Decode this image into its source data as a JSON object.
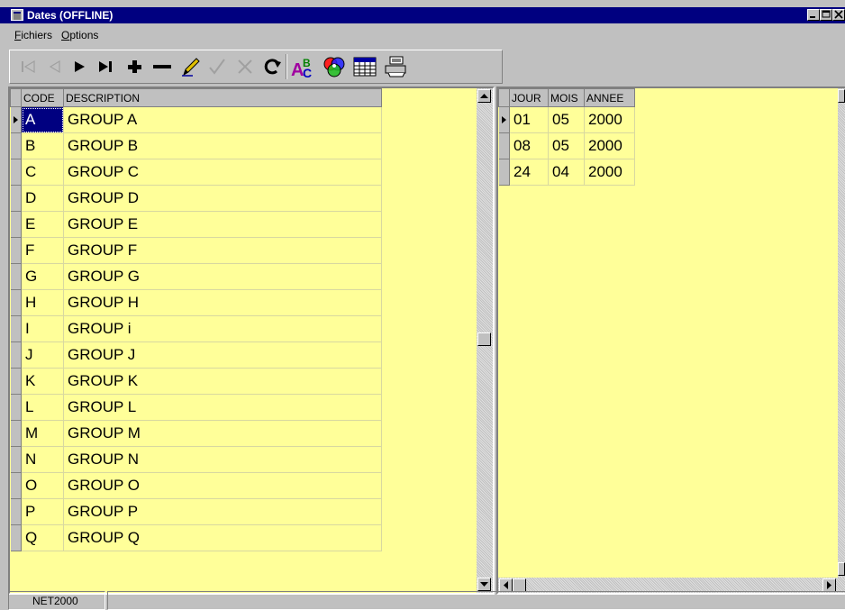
{
  "window": {
    "title": "Dates (OFFLINE)"
  },
  "menu": {
    "items": [
      {
        "label": "Fichiers"
      },
      {
        "label": "Options"
      }
    ]
  },
  "toolbar": {
    "buttons": [
      {
        "icon": "first-record-icon",
        "enabled": false
      },
      {
        "icon": "prior-record-icon",
        "enabled": false
      },
      {
        "icon": "next-record-icon",
        "enabled": true
      },
      {
        "icon": "last-record-icon",
        "enabled": true
      },
      {
        "icon": "insert-record-icon",
        "enabled": true
      },
      {
        "icon": "delete-record-icon",
        "enabled": true
      },
      {
        "icon": "edit-record-icon",
        "enabled": true
      },
      {
        "icon": "post-edit-icon",
        "enabled": false
      },
      {
        "icon": "cancel-edit-icon",
        "enabled": false
      },
      {
        "icon": "refresh-icon",
        "enabled": true
      },
      {
        "icon": "spelling-icon",
        "enabled": true
      },
      {
        "icon": "color-palette-icon",
        "enabled": true
      },
      {
        "icon": "calendar-icon",
        "enabled": true
      },
      {
        "icon": "printer-icon",
        "enabled": true
      }
    ]
  },
  "groups_grid": {
    "columns": [
      "CODE",
      "DESCRIPTION"
    ],
    "rows": [
      [
        "A",
        "GROUP A"
      ],
      [
        "B",
        "GROUP B"
      ],
      [
        "C",
        "GROUP C"
      ],
      [
        "D",
        "GROUP D"
      ],
      [
        "E",
        "GROUP E"
      ],
      [
        "F",
        "GROUP F"
      ],
      [
        "G",
        "GROUP G"
      ],
      [
        "H",
        "GROUP H"
      ],
      [
        "I",
        "GROUP i"
      ],
      [
        "J",
        "GROUP J"
      ],
      [
        "K",
        "GROUP K"
      ],
      [
        "L",
        "GROUP L"
      ],
      [
        "M",
        "GROUP M"
      ],
      [
        "N",
        "GROUP N"
      ],
      [
        "O",
        "GROUP O"
      ],
      [
        "P",
        "GROUP P"
      ],
      [
        "Q",
        "GROUP Q"
      ]
    ],
    "current_row": 0
  },
  "dates_grid": {
    "columns": [
      "JOUR",
      "MOIS",
      "ANNEE"
    ],
    "rows": [
      [
        "01",
        "05",
        "2000"
      ],
      [
        "08",
        "05",
        "2000"
      ],
      [
        "24",
        "04",
        "2000"
      ]
    ],
    "current_row": 0
  },
  "statusbar": {
    "panel1": "NET2000"
  },
  "colors": {
    "grid_background": "#ffff99",
    "titlebar": "#000080",
    "face": "#c0c0c0",
    "selection": "#000080"
  }
}
